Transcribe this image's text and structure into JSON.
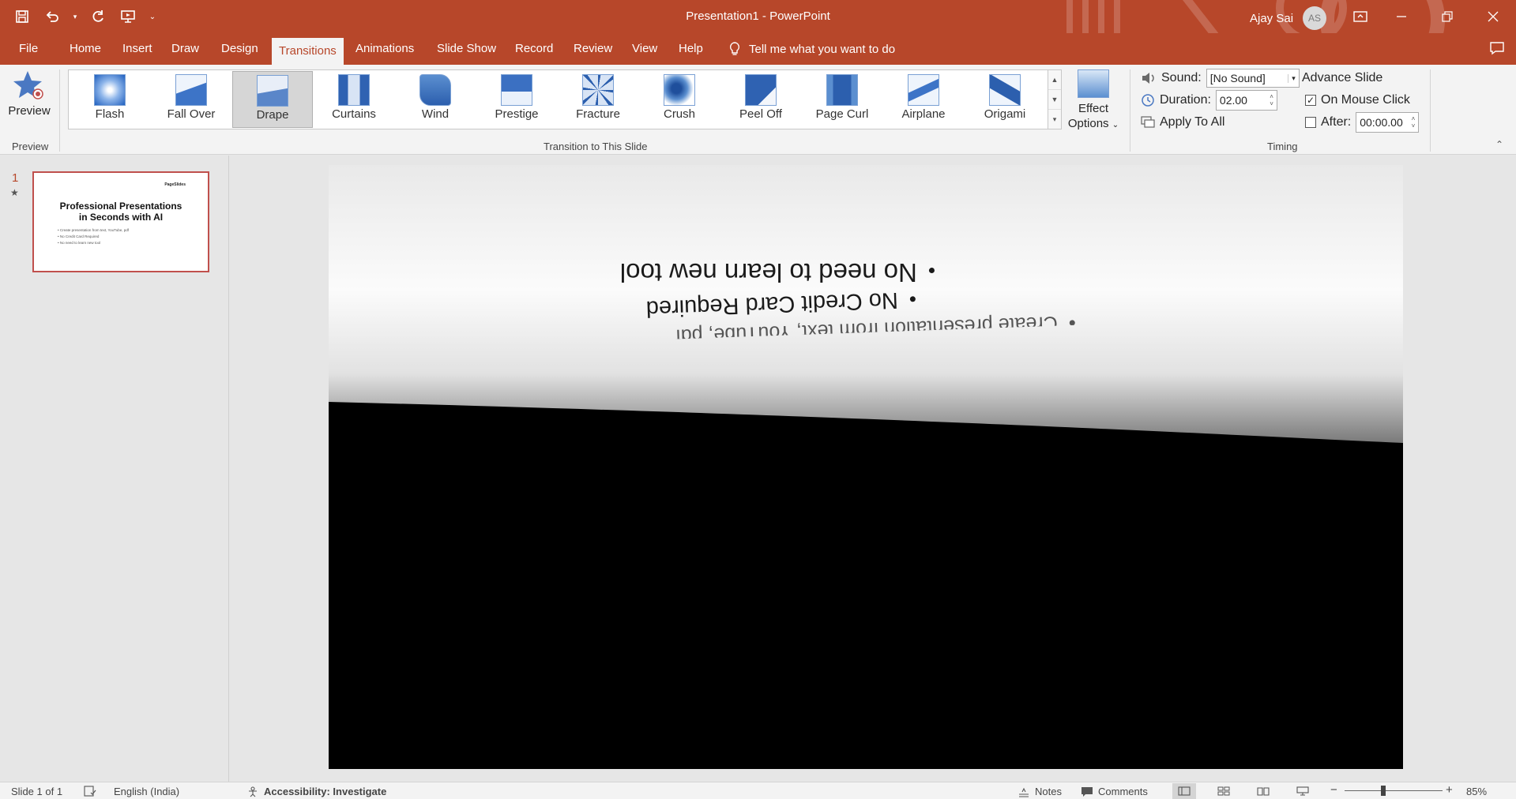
{
  "app": {
    "title": "Presentation1  -  PowerPoint",
    "user_name": "Ajay Sai",
    "user_initials": "AS"
  },
  "ribbon_tabs": [
    "File",
    "Home",
    "Insert",
    "Draw",
    "Design",
    "Transitions",
    "Animations",
    "Slide Show",
    "Record",
    "Review",
    "View",
    "Help"
  ],
  "active_tab": "Transitions",
  "tell_me": "Tell me what you want to do",
  "preview": {
    "button_label": "Preview",
    "group_label": "Preview"
  },
  "transitions": {
    "group_label": "Transition to This Slide",
    "items": [
      "Flash",
      "Fall Over",
      "Drape",
      "Curtains",
      "Wind",
      "Prestige",
      "Fracture",
      "Crush",
      "Peel Off",
      "Page Curl",
      "Airplane",
      "Origami"
    ],
    "selected": "Drape",
    "effect_options_line1": "Effect",
    "effect_options_line2": "Options"
  },
  "timing": {
    "group_label": "Timing",
    "sound_label": "Sound:",
    "sound_value": "[No Sound]",
    "duration_label": "Duration:",
    "duration_value": "02.00",
    "apply_to_all": "Apply To All",
    "advance_slide": "Advance Slide",
    "on_mouse_click": "On Mouse Click",
    "on_mouse_click_checked": true,
    "after_label": "After:",
    "after_value": "00:00.00",
    "after_checked": false
  },
  "slide_panel": {
    "slide_number": "1",
    "thumb_logo": "PageSlides",
    "thumb_title_line1": "Professional Presentations",
    "thumb_title_line2": "in Seconds with AI",
    "thumb_bullets": [
      "Create presentation from text, YouTube, pdf",
      "No Credit Card Required",
      "No need to learn new tool"
    ]
  },
  "slide_canvas": {
    "visible_lines": [
      "No need to learn new tool",
      "No Credit Card Required",
      "Create presentation from text, YouTube, pdf"
    ]
  },
  "status": {
    "slide_info": "Slide 1 of 1",
    "language": "English (India)",
    "accessibility": "Accessibility: Investigate",
    "notes": "Notes",
    "comments": "Comments",
    "zoom": "85%"
  }
}
